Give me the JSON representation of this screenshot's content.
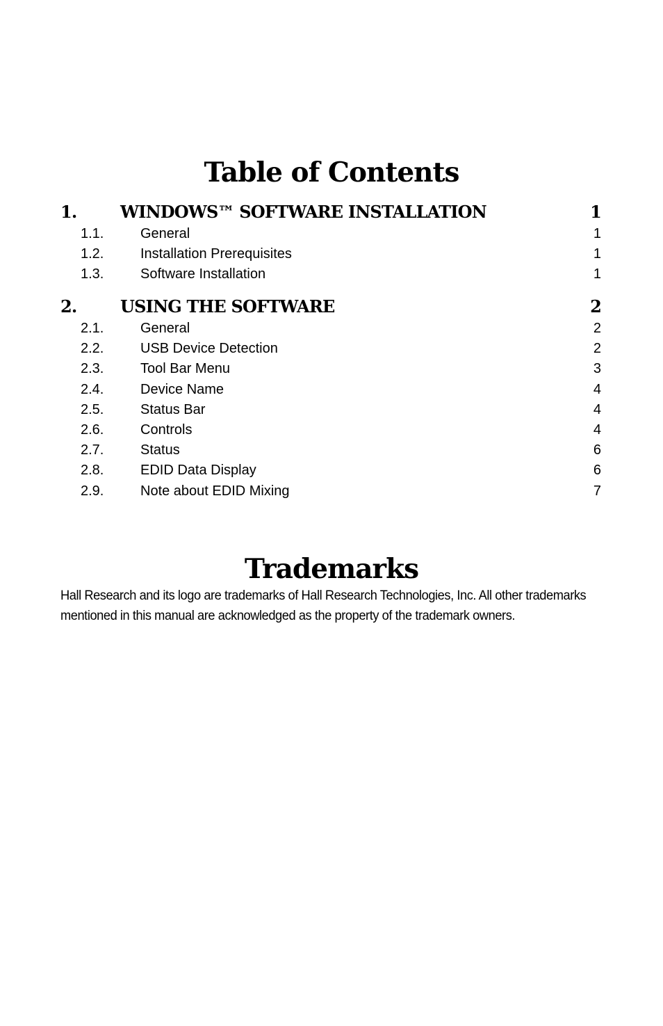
{
  "toc": {
    "title": "Table of Contents",
    "sections": [
      {
        "number": "1.",
        "title": "WINDOWS™ SOFTWARE INSTALLATION",
        "page": "1",
        "subsections": [
          {
            "number": "1.1.",
            "title": "General",
            "page": "1"
          },
          {
            "number": "1.2.",
            "title": "Installation Prerequisites",
            "page": "1"
          },
          {
            "number": "1.3.",
            "title": "Software Installation",
            "page": "1"
          }
        ]
      },
      {
        "number": "2.",
        "title": "USING THE SOFTWARE",
        "page": "2",
        "subsections": [
          {
            "number": "2.1.",
            "title": "General",
            "page": "2"
          },
          {
            "number": "2.2.",
            "title": "USB Device Detection",
            "page": "2"
          },
          {
            "number": "2.3.",
            "title": "Tool Bar Menu",
            "page": "3"
          },
          {
            "number": "2.4.",
            "title": "Device Name",
            "page": "4"
          },
          {
            "number": "2.5.",
            "title": "Status Bar",
            "page": "4"
          },
          {
            "number": "2.6.",
            "title": "Controls",
            "page": "4"
          },
          {
            "number": "2.7.",
            "title": "Status",
            "page": "6"
          },
          {
            "number": "2.8.",
            "title": "EDID Data Display",
            "page": "6"
          },
          {
            "number": "2.9.",
            "title": "Note about EDID Mixing",
            "page": "7"
          }
        ]
      }
    ]
  },
  "trademarks": {
    "title": "Trademarks",
    "body": "Hall Research and its logo are trademarks of Hall Research Technologies, Inc. All other trademarks mentioned in this manual are acknowledged as the property of the trademark owners."
  }
}
